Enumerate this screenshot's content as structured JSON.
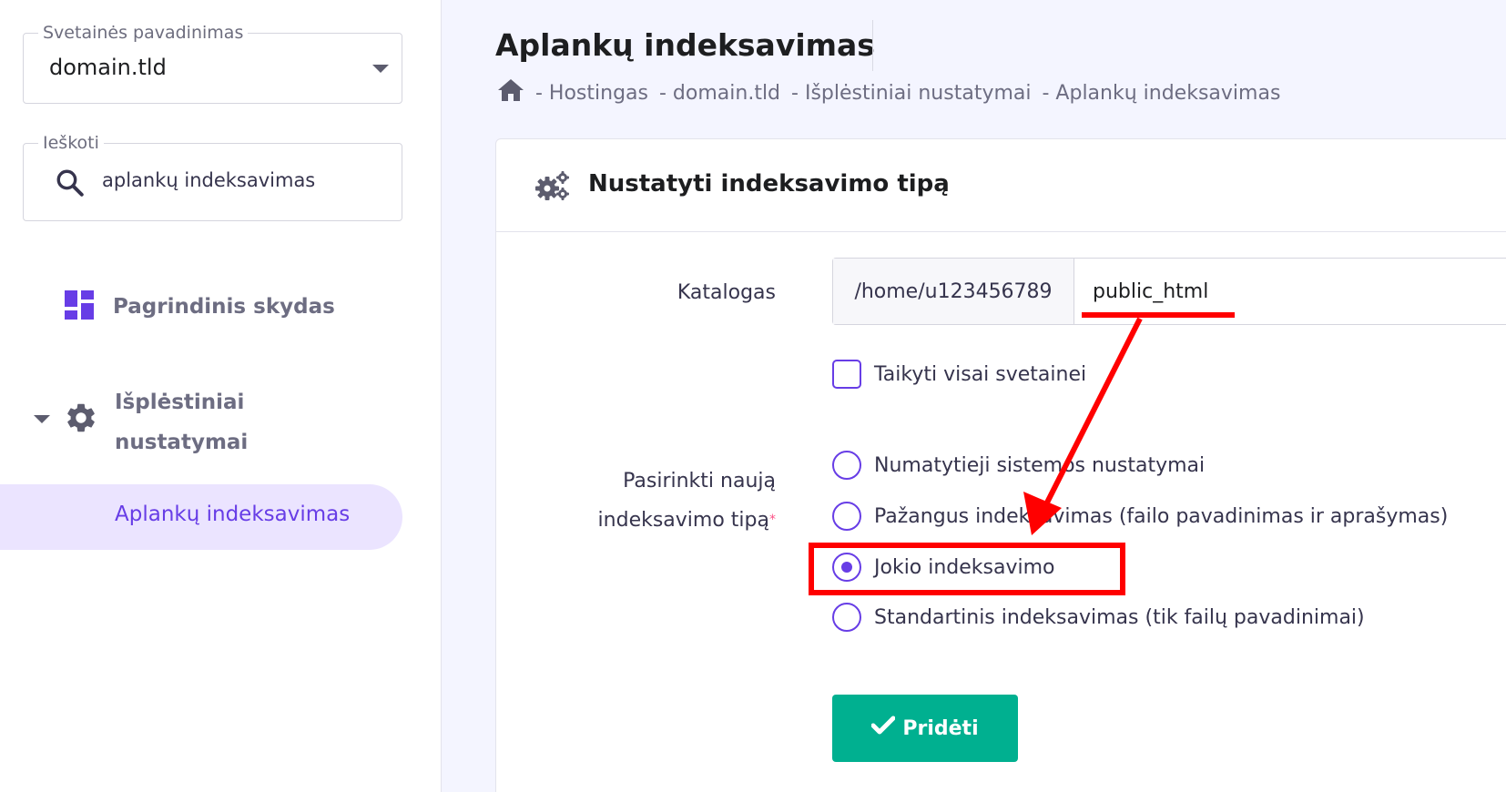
{
  "sidebar": {
    "site_select": {
      "legend": "Svetainės pavadinimas",
      "value": "domain.tld"
    },
    "search": {
      "legend": "Ieškoti",
      "value": "aplankų indeksavimas"
    },
    "items": [
      {
        "label": "Pagrindinis skydas",
        "icon": "dashboard-icon"
      },
      {
        "label": "Išplėstiniai nustatymai",
        "icon": "gear-icon",
        "expanded": true
      },
      {
        "label": "Aplankų indeksavimas",
        "active": true
      }
    ]
  },
  "header": {
    "title": "Aplankų indeksavimas",
    "breadcrumb": [
      "- Hostingas",
      "- domain.tld",
      "- Išplėstiniai nustatymai",
      "- Aplankų indeksavimas"
    ]
  },
  "card": {
    "title": "Nustatyti indeksavimo tipą",
    "directory_label": "Katalogas",
    "directory_prefix": "/home/u123456789",
    "directory_value": "public_html",
    "apply_all_label": "Taikyti visai svetainei",
    "apply_all_checked": false,
    "type_label": "Pasirinkti naują indeksavimo tipą",
    "required_mark": "*",
    "options": [
      {
        "label": "Numatytieji sistemos nustatymai",
        "checked": false
      },
      {
        "label": "Pažangus indeksavimas (failo pavadinimas ir aprašymas)",
        "checked": false
      },
      {
        "label": "Jokio indeksavimo",
        "checked": true
      },
      {
        "label": "Standartinis indeksavimas (tik failų pavadinimai)",
        "checked": false
      }
    ],
    "submit_label": "Pridėti"
  },
  "colors": {
    "accent": "#673de6",
    "success": "#00b090",
    "annotation": "#ff0000",
    "active_bg": "#ebe4ff"
  }
}
